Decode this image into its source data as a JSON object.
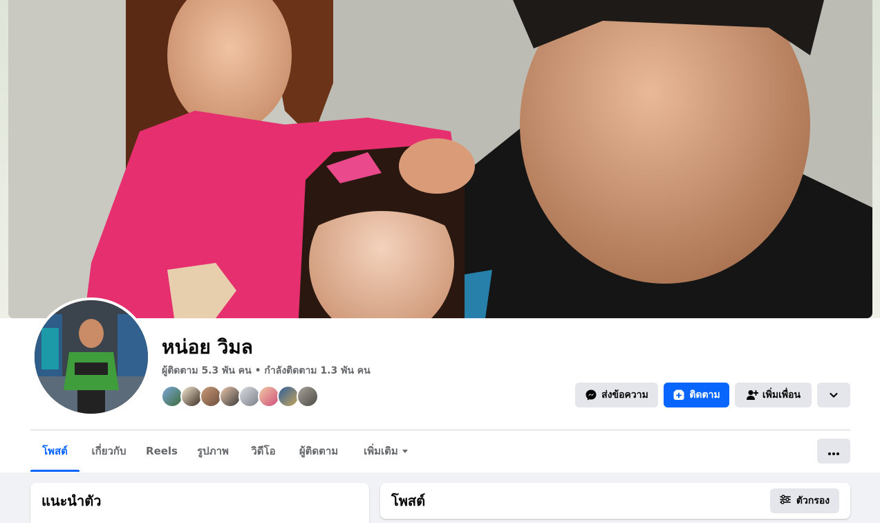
{
  "profile": {
    "name": "หน่อย วิมล",
    "stats": "ผู้ติดตาม 5.3 พัน คน • กำลังติดตาม 1.3 พัน คน"
  },
  "actions": {
    "message_label": "ส่งข้อความ",
    "follow_label": "ติดตาม",
    "add_friend_label": "เพิ่มเพื่อน"
  },
  "tabs": [
    {
      "label": "โพสต์"
    },
    {
      "label": "เกี่ยวกับ"
    },
    {
      "label": "Reels"
    },
    {
      "label": "รูปภาพ"
    },
    {
      "label": "วิดีโอ"
    },
    {
      "label": "ผู้ติดตาม"
    },
    {
      "label": "เพิ่มเติม"
    }
  ],
  "intro_card": {
    "title": "แนะนำตัว"
  },
  "posts_card": {
    "title": "โพสต์",
    "filter_label": "ตัวกรอง"
  },
  "colors": {
    "accent": "#0866ff",
    "secondary_button": "#e4e6eb",
    "page_background": "#f0f2f5"
  },
  "icons": [
    "messenger-icon",
    "follow-icon",
    "add-friend-icon",
    "chevron-down-icon",
    "more-dots-icon",
    "filter-icon"
  ]
}
